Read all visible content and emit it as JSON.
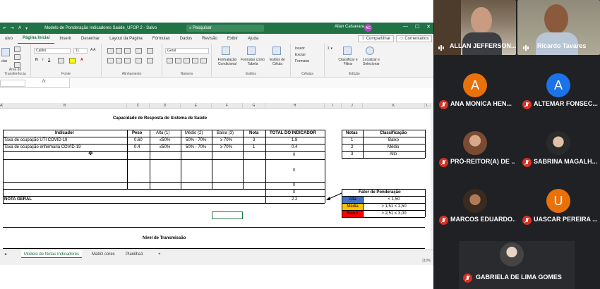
{
  "excel": {
    "doc_title": "Modelo de Ponderação Indicadores Saúde_UFOP 2  -  Salvo",
    "search_placeholder": "Pesquisar",
    "user_name": "Allan Calsavara",
    "user_initials": "AC",
    "menu_tabs": [
      "uivo",
      "Página Inicial",
      "Inserir",
      "Desenhar",
      "Layout da Página",
      "Fórmulas",
      "Dados",
      "Revisão",
      "Exibir",
      "Ajuda"
    ],
    "share_label": "Compartilhar",
    "comments_label": "Comentários",
    "ribbon": {
      "font_name": "Calibri",
      "font_size": "11",
      "number_format": "Geral",
      "groups": [
        "Área de Transferência",
        "Fonte",
        "Alinhamento",
        "Número",
        "Estilos",
        "Células",
        "Edição"
      ],
      "styles_items": [
        "Formatação Condicional",
        "Formatar como Tabela",
        "Estilos de Célula"
      ],
      "cells_items": [
        "Inserir",
        "Excluir",
        "Formatar"
      ],
      "edit_items": [
        "Classificar e Filtrar",
        "Localizar e Selecionar"
      ],
      "paste_hint": "olar"
    },
    "columns": [
      "A",
      "B",
      "C",
      "D",
      "E",
      "F",
      "G",
      "H",
      "I",
      "J",
      "K",
      "L"
    ],
    "sheet": {
      "title": "Capacidade de Resposta do Sistema de Saúde",
      "headers": [
        "Indicador",
        "Peso",
        "Alta (1)",
        "Médio (2)",
        "Baixa (3)",
        "Nota",
        "TOTAL DO INDICADOR"
      ],
      "rows": [
        [
          "Taxa de ocupação UTI COVID-19",
          "0.60",
          "≤50%",
          "50% - 70%",
          "≥ 70%",
          "3",
          "1.8"
        ],
        [
          "Taxa de ocupação enfermaria COVID-19",
          "0.4",
          "≤50%",
          "50% - 70%",
          "≥ 70%",
          "1",
          "0.4"
        ]
      ],
      "empty_totals": [
        "0",
        "0",
        "0",
        "0"
      ],
      "nota_geral_label": "NOTA GERAL",
      "nota_geral_value": "2.2",
      "class_headers": [
        "Notas",
        "Classificação"
      ],
      "class_rows": [
        [
          "1",
          "Baixo"
        ],
        [
          "2",
          "Médio"
        ],
        [
          "3",
          "Alto"
        ]
      ],
      "fator_title": "Fator de Ponderação",
      "fator_rows": [
        {
          "label": "Alta",
          "value": "< 1,50",
          "color": "#4472c4"
        },
        {
          "label": "Média",
          "value": "> 1,51 < 2,50",
          "color": "#ffc000"
        },
        {
          "label": "Baixa",
          "value": "> 2,51 ≤ 3,00",
          "color": "#ff0000"
        }
      ],
      "second_title": "Nível de Transmissão"
    },
    "sheet_tabs": [
      "Modelo de Notas Indicadores",
      "Matriz cores",
      "Planilha1"
    ],
    "add_sheet": "+",
    "zoom": "110%"
  },
  "meeting": {
    "participants": [
      {
        "name": "ALLAN JEFFERSON...",
        "muted": false,
        "video": true
      },
      {
        "name": "Ricardo Tavares",
        "muted": false,
        "video": true
      },
      {
        "name": "ANA MONICA HEN...",
        "initial": "A",
        "color": "#e8710a",
        "muted": true
      },
      {
        "name": "ALTEMAR FONSEC...",
        "initial": "A",
        "color": "#1a73e8",
        "muted": true
      },
      {
        "name": "PRÓ-REITOR(A) DE ...",
        "muted": true,
        "photo": true
      },
      {
        "name": "SABRINA MAGALH...",
        "muted": true,
        "photo": true
      },
      {
        "name": "MARCOS EDUARDO...",
        "muted": true,
        "photo": true
      },
      {
        "name": "UASCAR PEREIRA ...",
        "initial": "U",
        "color": "#e8710a",
        "muted": true
      },
      {
        "name": "GABRIELA DE LIMA GOMES",
        "muted": true,
        "photo": true
      }
    ]
  }
}
